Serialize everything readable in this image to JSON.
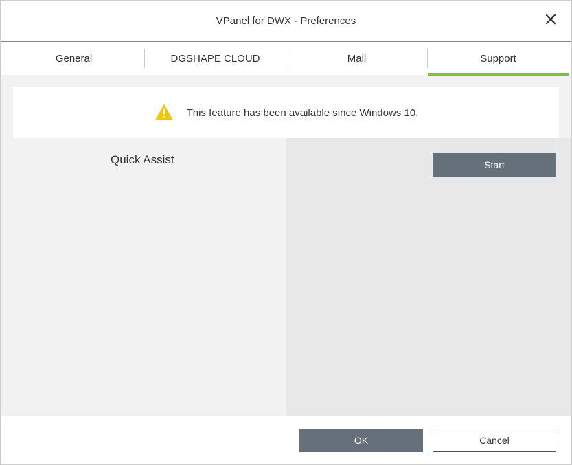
{
  "window": {
    "title": "VPanel for DWX - Preferences"
  },
  "tabs": {
    "general": "General",
    "dgshape_cloud": "DGSHAPE CLOUD",
    "mail": "Mail",
    "support": "Support"
  },
  "banner": {
    "text": "This feature has been available since Windows 10."
  },
  "support": {
    "quick_assist_label": "Quick Assist",
    "start_label": "Start"
  },
  "footer": {
    "ok_label": "OK",
    "cancel_label": "Cancel"
  },
  "colors": {
    "accent": "#7ac142",
    "button_dark": "#65707a",
    "warning": "#f6c500"
  }
}
